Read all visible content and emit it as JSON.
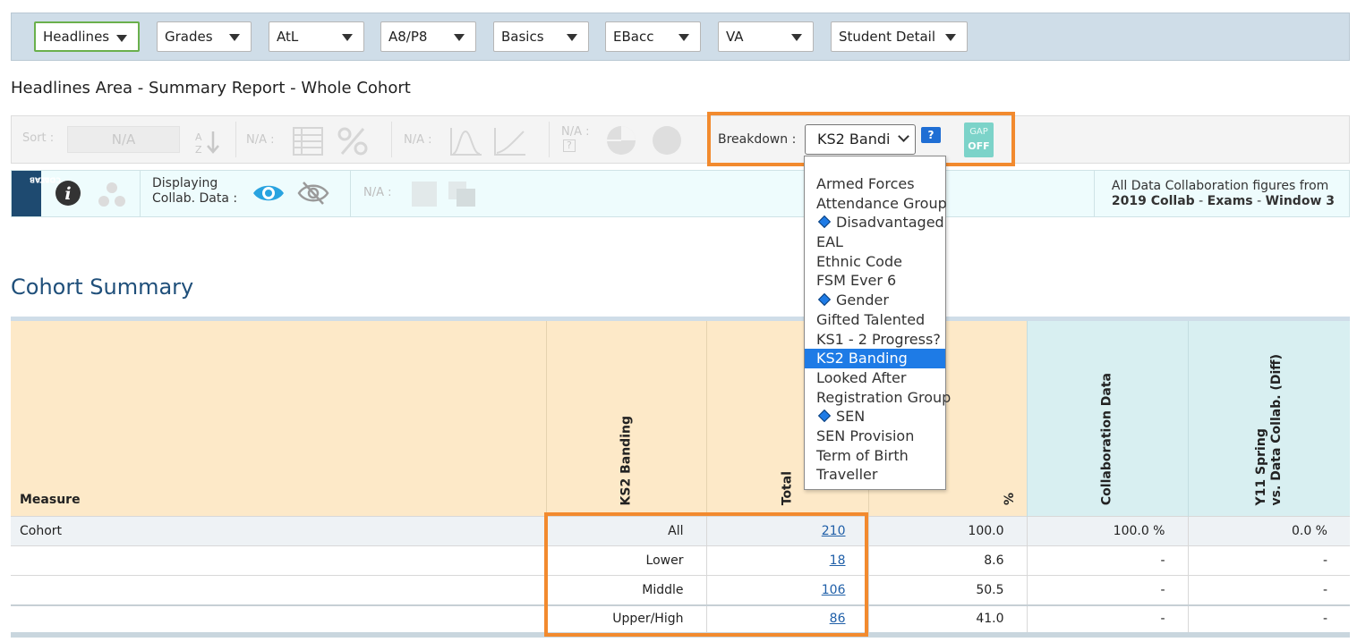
{
  "nav": {
    "items": [
      {
        "label": "Headlines",
        "active": true
      },
      {
        "label": "Grades"
      },
      {
        "label": "AtL"
      },
      {
        "label": "A8/P8"
      },
      {
        "label": "Basics"
      },
      {
        "label": "EBacc"
      },
      {
        "label": "VA"
      },
      {
        "label": "Student Detail"
      }
    ]
  },
  "page": {
    "area_title": "Headlines Area - Summary Report - Whole Cohort",
    "section_title": "Cohort Summary"
  },
  "toolbar": {
    "sort_label": "Sort :",
    "sort_value": "N/A",
    "na1": "N/A :",
    "na2": "N/A :",
    "na3_top": "N/A :",
    "na3_bottom": "?",
    "breakdown_label": "Breakdown :",
    "breakdown_value": "KS2 Bandi",
    "help_label": "?",
    "gap_top": "GAP",
    "gap_bottom": "OFF"
  },
  "collab": {
    "badge_line1": "DATA",
    "badge_line2": "COLLAB",
    "info_label": "i",
    "displaying_line1": "Displaying",
    "displaying_line2": "Collab. Data :",
    "na_label": "N/A :",
    "right_line1": "All Data Collaboration figures from",
    "right_line2_a": "2019 Collab",
    "right_line2_sep1": " - ",
    "right_line2_b": "Exams",
    "right_line2_sep2": " - ",
    "right_line2_c": "Window 3"
  },
  "dropdown": {
    "options": [
      {
        "label": "Armed Forces",
        "diamond": false
      },
      {
        "label": "Attendance Group",
        "diamond": false
      },
      {
        "label": "Disadvantaged",
        "diamond": true
      },
      {
        "label": "EAL",
        "diamond": false
      },
      {
        "label": "Ethnic Code",
        "diamond": false
      },
      {
        "label": "FSM Ever 6",
        "diamond": false
      },
      {
        "label": "Gender",
        "diamond": true
      },
      {
        "label": "Gifted Talented",
        "diamond": false
      },
      {
        "label": "KS1 - 2 Progress?",
        "diamond": false
      },
      {
        "label": "KS2 Banding",
        "diamond": false,
        "selected": true
      },
      {
        "label": "Looked After",
        "diamond": false
      },
      {
        "label": "Registration Group",
        "diamond": false
      },
      {
        "label": "SEN",
        "diamond": true
      },
      {
        "label": "SEN Provision",
        "diamond": false
      },
      {
        "label": "Term of Birth",
        "diamond": false
      },
      {
        "label": "Traveller",
        "diamond": false
      }
    ]
  },
  "table": {
    "headers": {
      "measure": "Measure",
      "ks2": "KS2 Banding",
      "total": "Total",
      "pct": "%",
      "collab": "Collaboration Data",
      "diff_line1": "Y11 Spring",
      "diff_line2": "vs. Data Collab. (Diff)"
    },
    "rows": [
      {
        "measure": "Cohort",
        "band": "All",
        "total": "210",
        "pct": "100.0",
        "collab": "100.0 %",
        "diff": "0.0 %"
      },
      {
        "measure": "",
        "band": "Lower",
        "total": "18",
        "pct": "8.6",
        "collab": "-",
        "diff": "-"
      },
      {
        "measure": "",
        "band": "Middle",
        "total": "106",
        "pct": "50.5",
        "collab": "-",
        "diff": "-"
      },
      {
        "measure": "",
        "band": "Upper/High",
        "total": "86",
        "pct": "41.0",
        "collab": "-",
        "diff": "-"
      }
    ]
  },
  "colors": {
    "accent_orange": "#f28a2e",
    "nav_bg": "#cfdde8",
    "header_peach": "#fde9c8",
    "header_blue": "#d8eff1",
    "link_blue": "#1f5fa8",
    "select_blue": "#1e7be6"
  },
  "icons": [
    "chevron-down-icon",
    "sort-az-icon",
    "table-icon",
    "percent-icon",
    "bell-curve-icon",
    "line-chart-icon",
    "pie-chart-icon",
    "circle-icon",
    "info-icon",
    "network-icon",
    "eye-icon",
    "eye-off-icon",
    "square-icon",
    "stack-icon",
    "diamond-icon"
  ]
}
